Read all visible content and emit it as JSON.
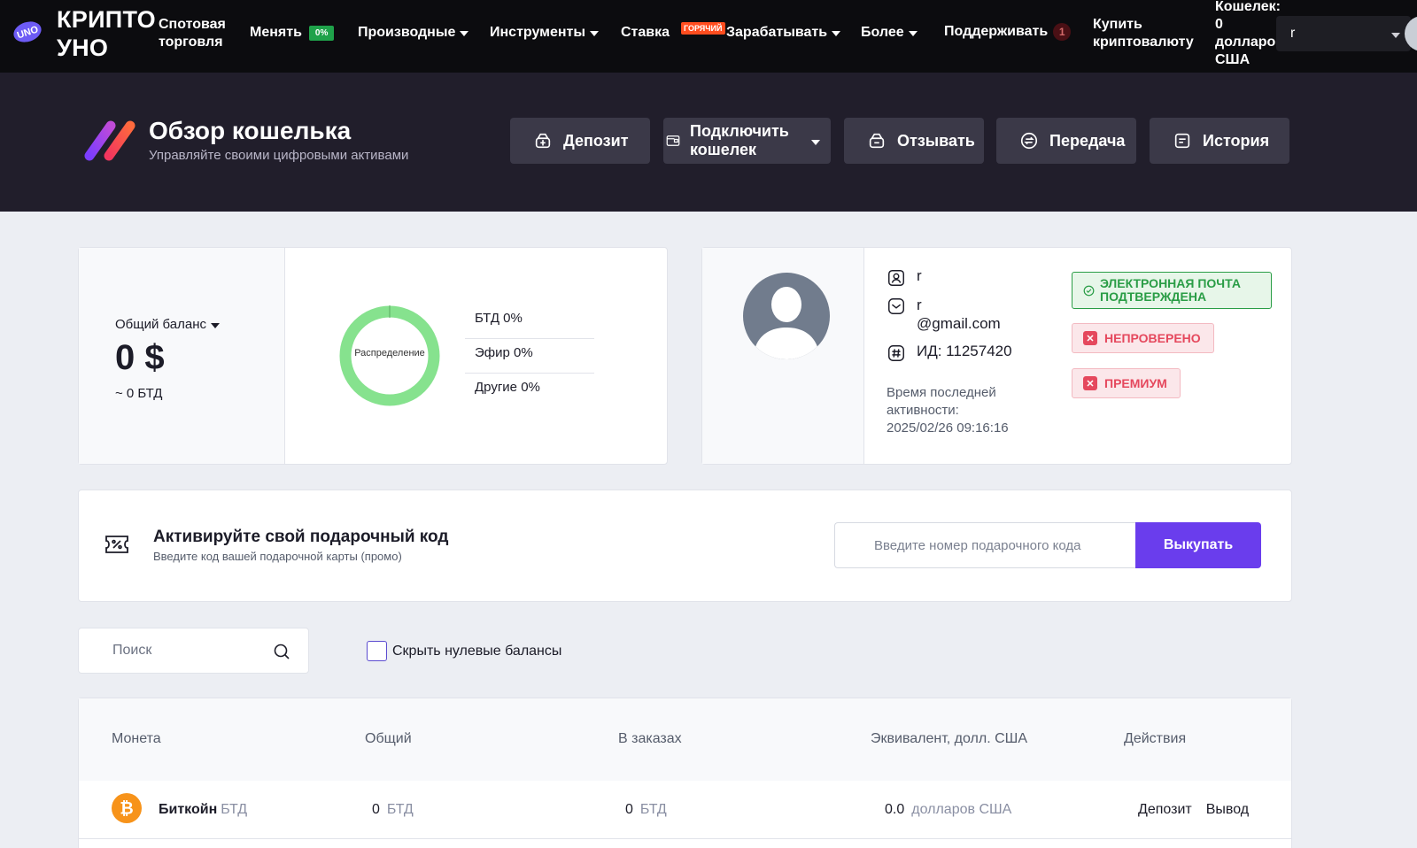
{
  "nav": {
    "brand": [
      "КРИПТО",
      "УНО"
    ],
    "logo_text": "UNO",
    "spot": [
      "Спотовая",
      "торговля"
    ],
    "exchange": "Менять",
    "exchange_badge": "0%",
    "derivatives": "Производные",
    "tools": "Инструменты",
    "staking": "Ставка",
    "staking_badge": "ГОРЯЧИЙ",
    "earn": "Зарабатывать",
    "more": "Более",
    "support": "Поддерживать",
    "support_count": "1",
    "buy": [
      "Купить",
      "криптовалюту"
    ],
    "wallet": [
      "Кошелек:",
      "0",
      "долларов",
      "США"
    ],
    "account_select": "r"
  },
  "hero": {
    "title": "Обзор кошелька",
    "subtitle": "Управляйте своими цифровыми активами",
    "buttons": {
      "deposit": "Депозит",
      "connect": [
        "Подключить",
        "кошелек"
      ],
      "withdraw": "Отзывать",
      "transfer": "Передача",
      "history": "История"
    }
  },
  "balance": {
    "label": "Общий баланс",
    "value": "0 $",
    "btc": "~ 0 БТД",
    "donut_label": "Распределение",
    "allocation": [
      "БТД 0%",
      "Эфир 0%",
      "Другие 0%"
    ]
  },
  "profile": {
    "name": "r",
    "email": [
      "r",
      "@gmail.com"
    ],
    "id": "ИД: 11257420",
    "last_activity": [
      "Время последней",
      "активности:",
      "2025/02/26 09:16:16"
    ],
    "email_badge": [
      "ЭЛЕКТРОННАЯ ПОЧТА",
      "ПОДТВЕРЖДЕНА"
    ],
    "unverified": "НЕПРОВЕРЕНО",
    "premium": "ПРЕМИУМ"
  },
  "gift": {
    "title": "Активируйте свой подарочный код",
    "subtitle": "Введите код вашей подарочной карты (промо)",
    "placeholder": "Введите номер подарочного кода",
    "button": "Выкупать"
  },
  "filters": {
    "search_placeholder": "Поиск",
    "hide_zero": "Скрыть нулевые балансы"
  },
  "table": {
    "headers": [
      "Монета",
      "Общий",
      "В заказах",
      "Эквивалент, долл. США",
      "Действия"
    ],
    "rows": [
      {
        "coin": "Биткойн",
        "symbol": "БТД",
        "total": "0",
        "total_unit": "БТД",
        "orders": "0",
        "orders_unit": "БТД",
        "usd": "0.0",
        "usd_unit": "долларов США",
        "deposit": "Депозит",
        "withdraw": "Вывод",
        "icon": "bitcoin-icon",
        "icon_color": "#f7931a"
      }
    ]
  },
  "colors": {
    "nav_bg": "#0c0c0f",
    "hero_bg": "#211e2b",
    "accent": "#6a3ded",
    "donut": "#86e28e",
    "success": "#2a9d46",
    "danger": "#e5485d"
  }
}
